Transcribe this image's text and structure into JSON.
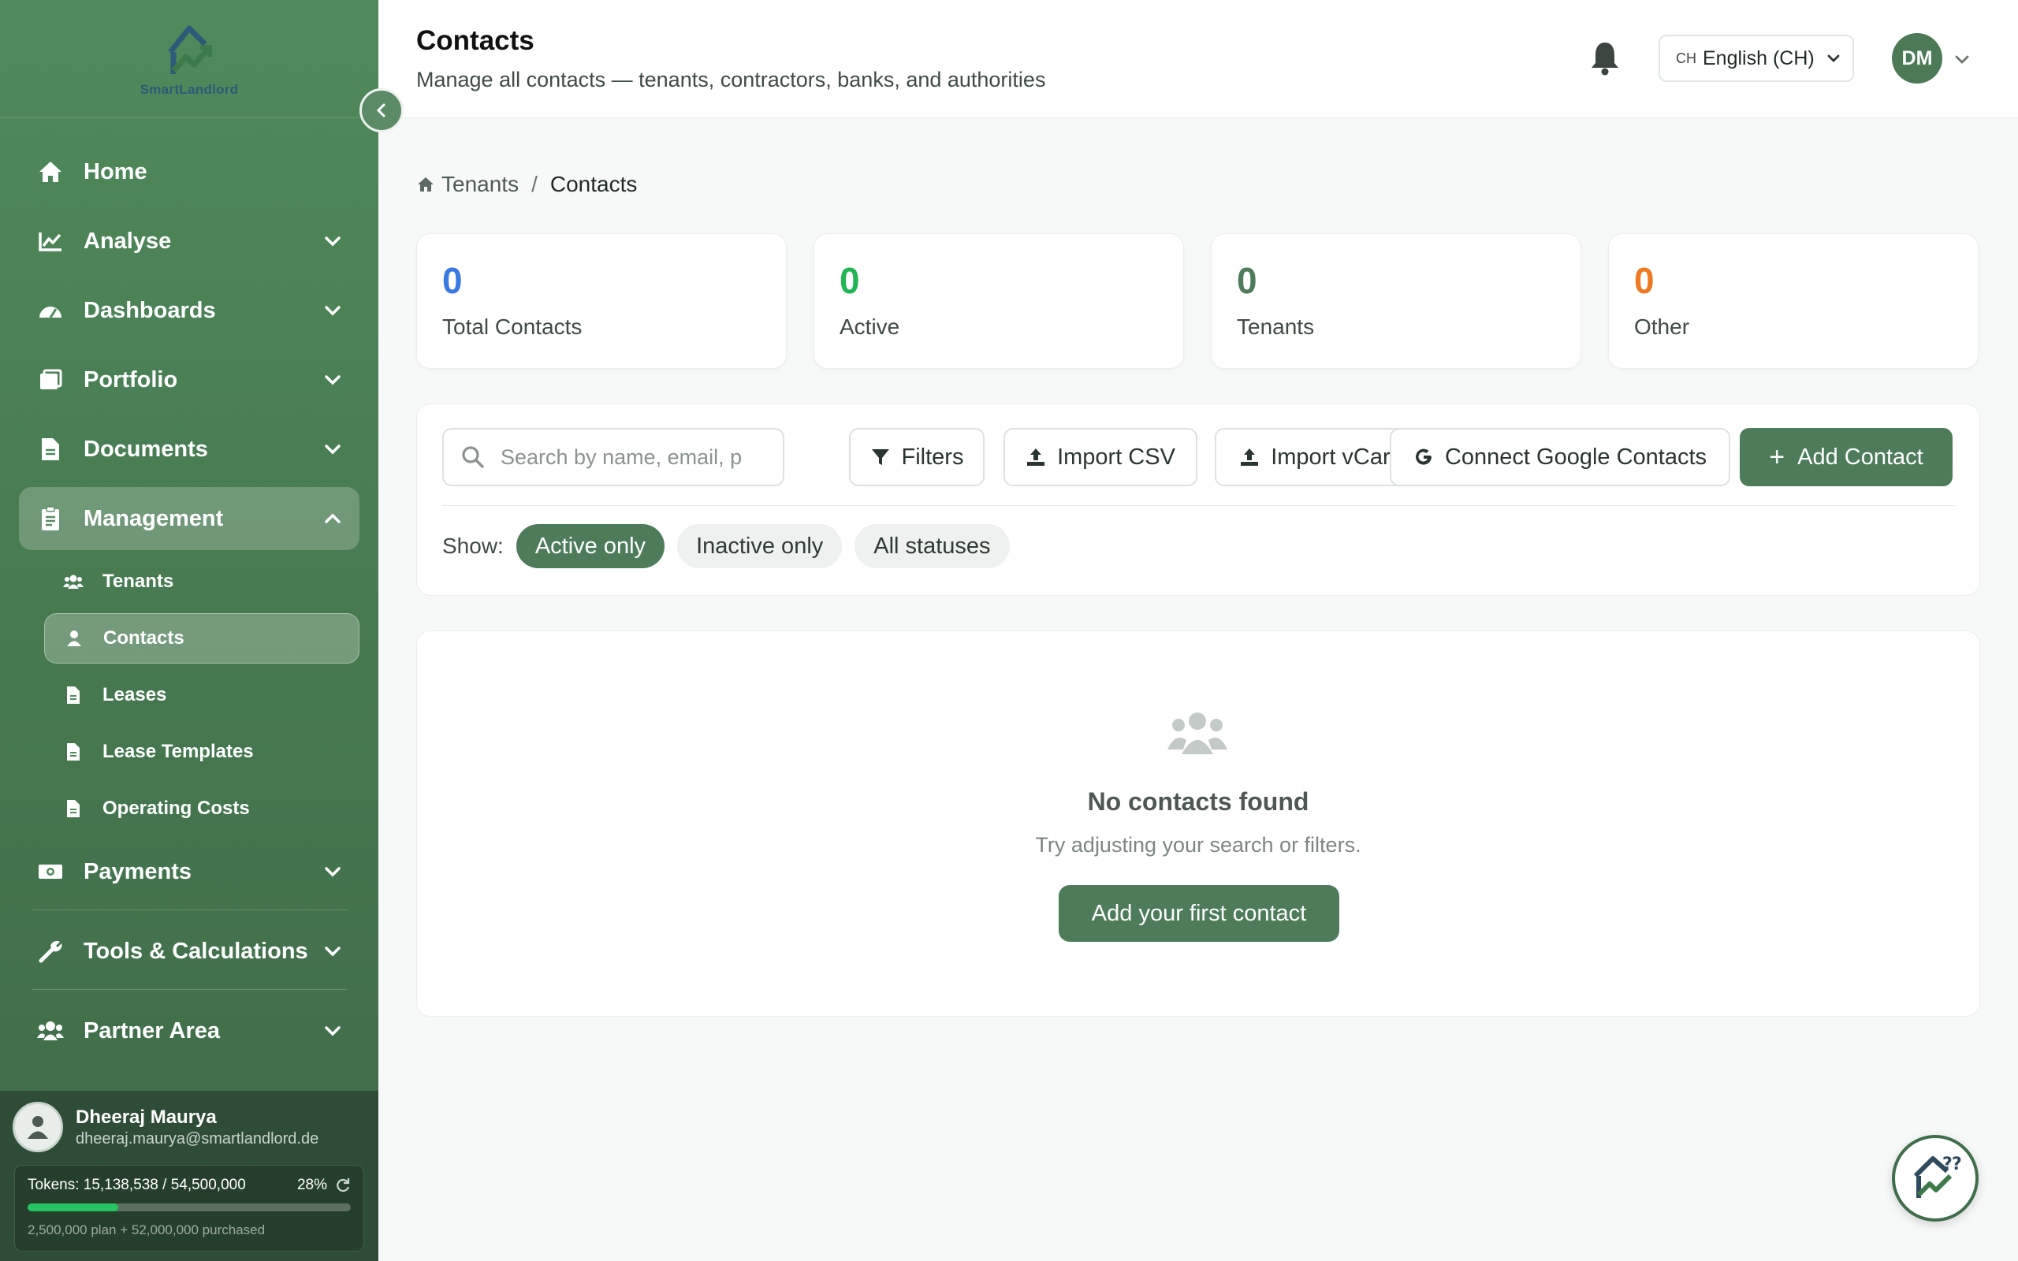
{
  "brand": {
    "logo_text": "SmartLandlord"
  },
  "sidebar": {
    "items": [
      {
        "label": "Home",
        "icon": "home-icon"
      },
      {
        "label": "Analyse",
        "icon": "chart-line-icon"
      },
      {
        "label": "Dashboards",
        "icon": "gauge-icon"
      },
      {
        "label": "Portfolio",
        "icon": "portfolio-icon"
      },
      {
        "label": "Documents",
        "icon": "document-icon"
      },
      {
        "label": "Management",
        "icon": "clipboard-icon"
      },
      {
        "label": "Payments",
        "icon": "money-icon"
      },
      {
        "label": "Tools & Calculations",
        "icon": "wrench-icon"
      },
      {
        "label": "Partner Area",
        "icon": "users-icon"
      }
    ],
    "sub_items": [
      {
        "label": "Tenants",
        "icon": "users-icon"
      },
      {
        "label": "Contacts",
        "icon": "user-icon"
      },
      {
        "label": "Leases",
        "icon": "file-icon"
      },
      {
        "label": "Lease Templates",
        "icon": "file-icon"
      },
      {
        "label": "Operating Costs",
        "icon": "file-icon"
      }
    ],
    "active_item": "Management",
    "active_sub_item": "Contacts"
  },
  "user": {
    "name": "Dheeraj Maurya",
    "email": "dheeraj.maurya@smartlandlord.de",
    "tokens_label": "Tokens: 15,138,538 / 54,500,000",
    "tokens_pct_label": "28%",
    "tokens_fraction": 0.28,
    "tokens_sub": "2,500,000 plan + 52,000,000 purchased"
  },
  "header": {
    "title": "Contacts",
    "subtitle": "Manage all contacts — tenants, contractors, banks, and authorities",
    "lang_code": "CH",
    "lang_label": "English (CH)",
    "avatar_initials": "DM"
  },
  "breadcrumb": {
    "parent": "Tenants",
    "current": "Contacts",
    "separator": "/"
  },
  "stats": [
    {
      "value": "0",
      "label": "Total Contacts",
      "color": "#3b7ae0"
    },
    {
      "value": "0",
      "label": "Active",
      "color": "#22b554"
    },
    {
      "value": "0",
      "label": "Tenants",
      "color": "#4e7c5a"
    },
    {
      "value": "0",
      "label": "Other",
      "color": "#ee7a22"
    }
  ],
  "toolbar": {
    "search_placeholder": "Search by name, email, p",
    "filters_label": "Filters",
    "import_csv_label": "Import CSV",
    "import_vcard_label": "Import vCard",
    "google_label": "Connect Google Contacts",
    "add_label": "Add Contact",
    "show_label": "Show:",
    "pills": [
      "Active only",
      "Inactive only",
      "All statuses"
    ],
    "active_pill": "Active only"
  },
  "empty_state": {
    "title": "No contacts found",
    "subtitle": "Try adjusting your search or filters.",
    "button_label": "Add your first contact",
    "icon": "users-icon"
  },
  "colors": {
    "primary": "#4e7c5a",
    "sidebar": "#46784f",
    "background": "#f7f8f8"
  }
}
